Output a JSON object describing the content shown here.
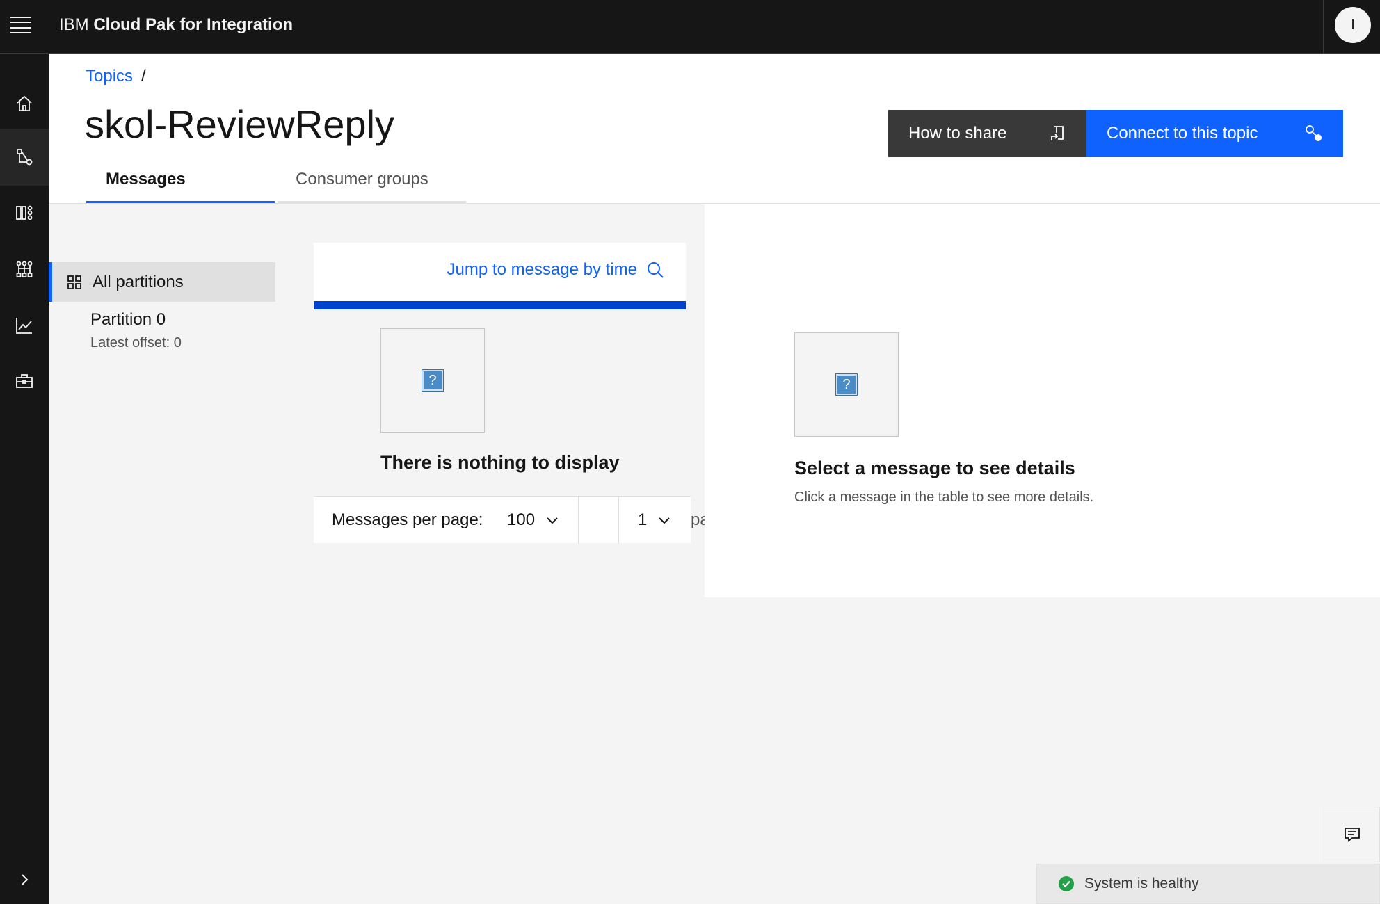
{
  "header": {
    "brand_light": "IBM",
    "brand_bold": "Cloud Pak for Integration",
    "user_initial": "I"
  },
  "rail": {
    "items": [
      {
        "icon": "home-icon"
      },
      {
        "icon": "topology-icon",
        "active": true
      },
      {
        "icon": "dashboard-icon"
      },
      {
        "icon": "network-icon"
      },
      {
        "icon": "chart-icon"
      },
      {
        "icon": "toolbox-icon"
      }
    ],
    "expand_icon": "chevron-right-icon"
  },
  "breadcrumb": {
    "link": "Topics",
    "separator": "/"
  },
  "page": {
    "title": "skol-ReviewReply"
  },
  "actions": {
    "share_label": "How to share",
    "connect_label": "Connect to this topic"
  },
  "tabs": [
    {
      "label": "Messages",
      "selected": true
    },
    {
      "label": "Consumer groups",
      "selected": false
    }
  ],
  "partitions": {
    "all_label": "All partitions",
    "items": [
      {
        "name": "Partition 0",
        "offset": "Latest offset: 0"
      }
    ]
  },
  "messages": {
    "jump_label": "Jump to message by time",
    "empty_title": "There is nothing to display",
    "per_page_label": "Messages per page:",
    "per_page_value": "100",
    "page_value": "1",
    "pages_text": "pa"
  },
  "details": {
    "title": "Select a message to see details",
    "subtitle": "Click a message in the table to see more details."
  },
  "status": {
    "label": "System is healthy",
    "color": "#24a148"
  },
  "colors": {
    "primary": "#0f62fe",
    "header_bg": "#161616",
    "secondary_button": "#393939"
  }
}
